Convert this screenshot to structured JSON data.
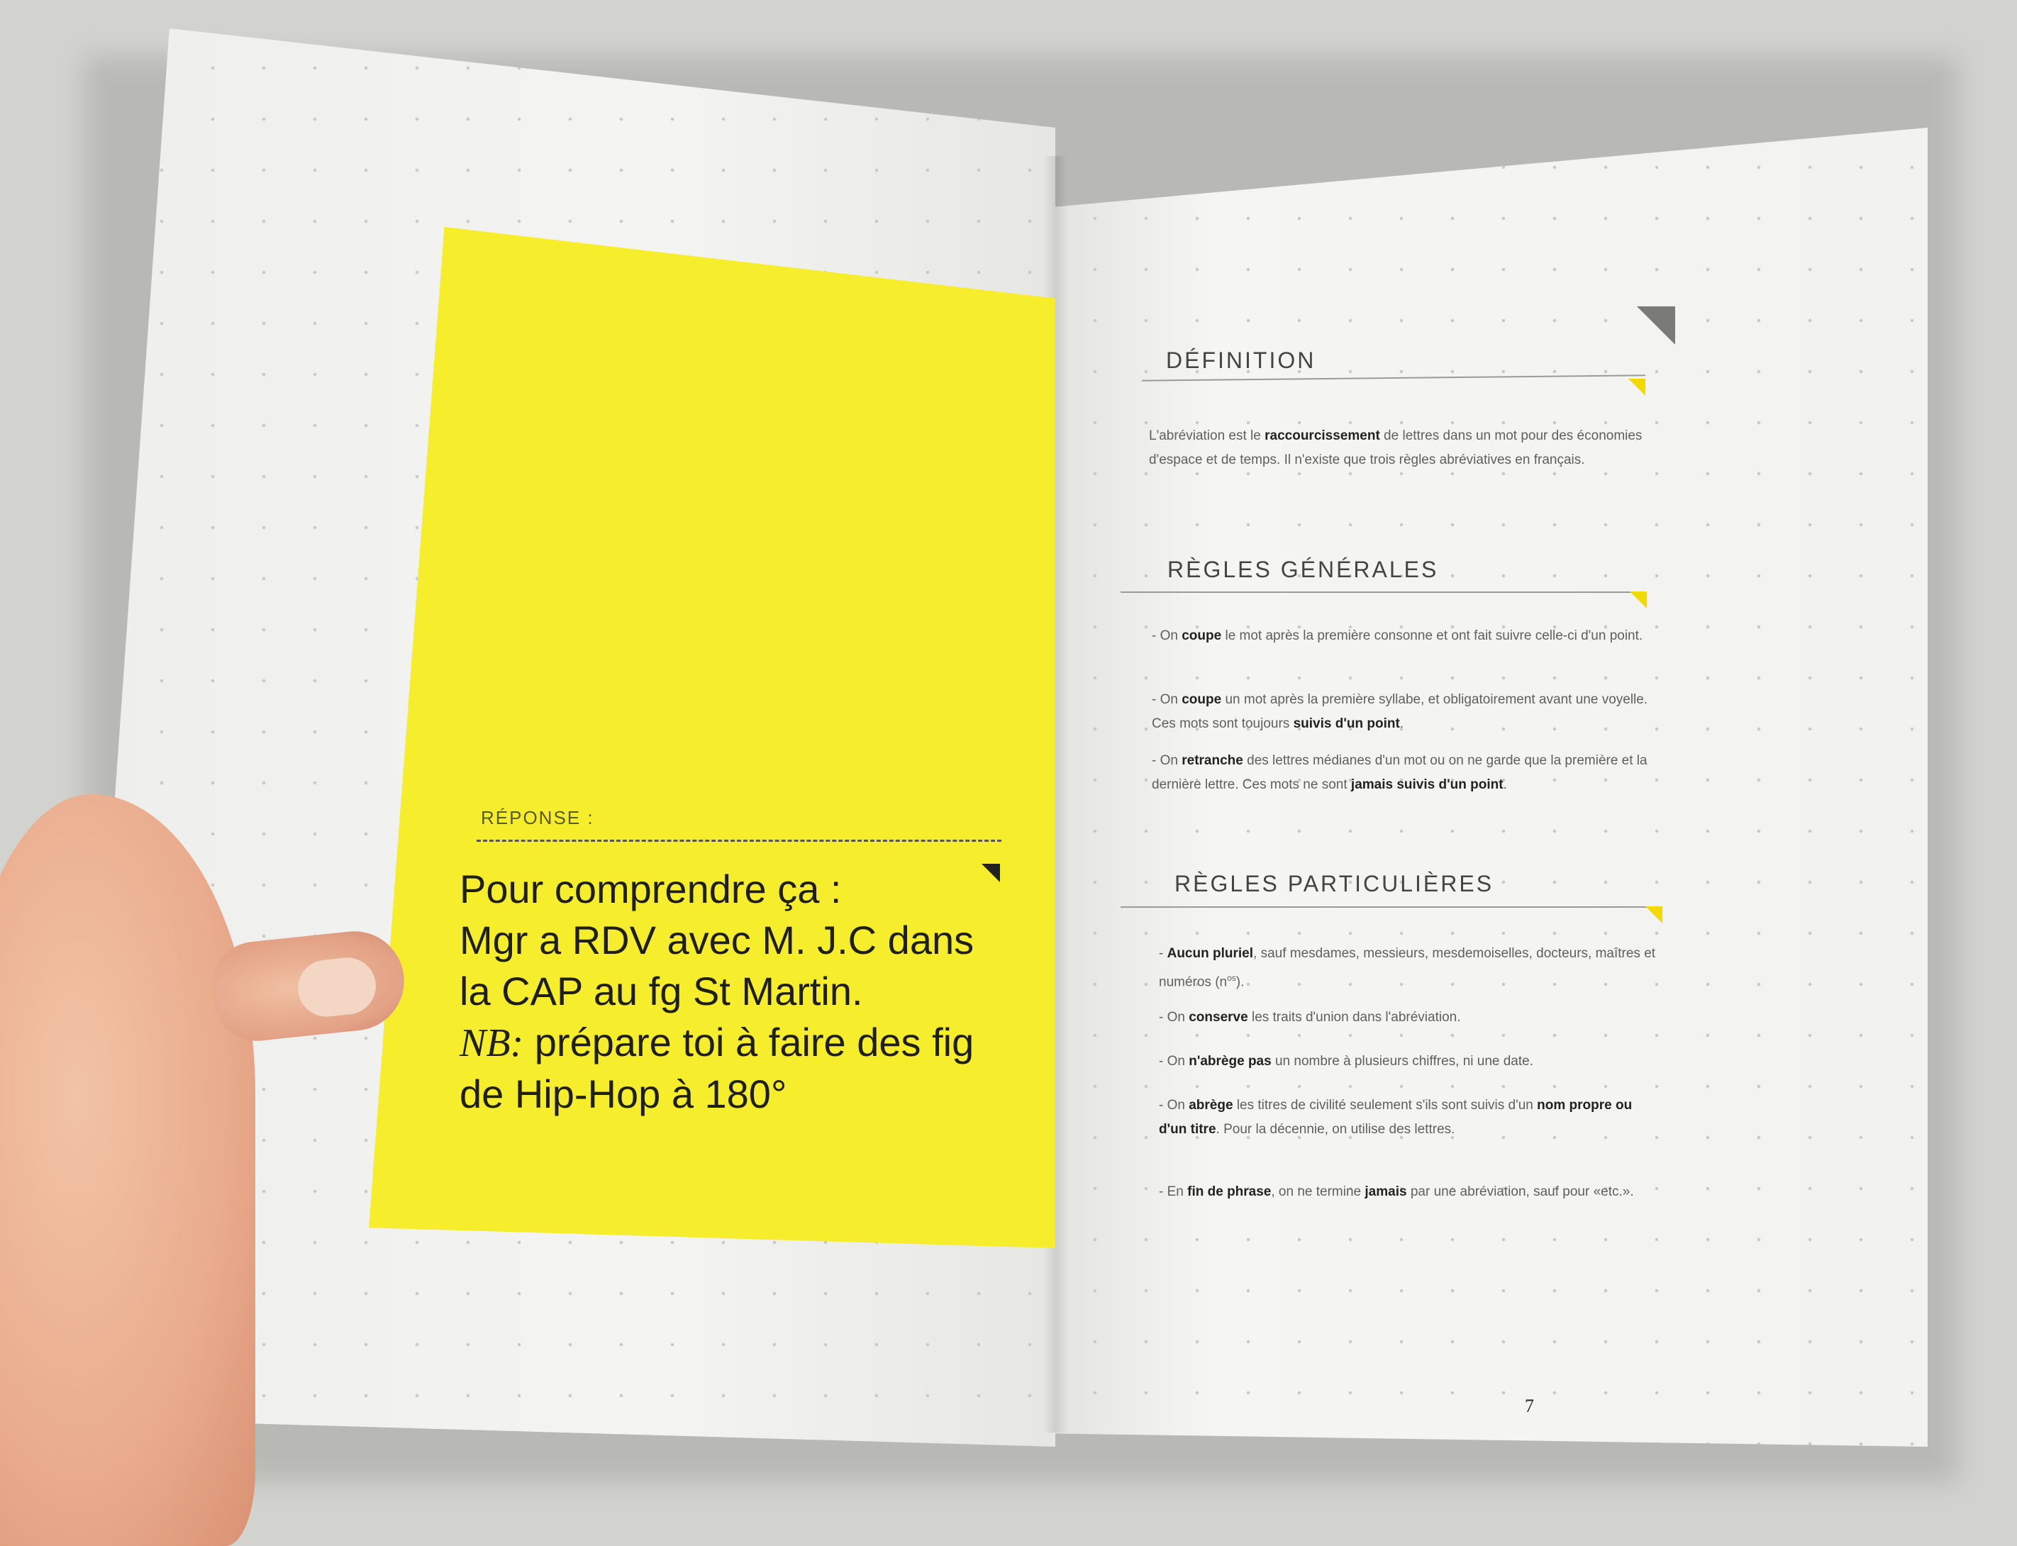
{
  "note": {
    "label": "RÉPONSE :",
    "lines": [
      "Pour comprendre ça :",
      "Mgr a RDV avec M. J.C dans",
      "la CAP au fg St Martin."
    ],
    "nb_label": "NB:",
    "nb_text": " prépare toi à faire des fig",
    "last_line": "de Hip-Hop à 180°"
  },
  "definition": {
    "title": "DÉFINITION",
    "text_before": "L'abréviation est le ",
    "bold": "raccourcissement",
    "text_after": " de lettres dans un mot pour des économies d'espace et de temps. Il n'existe que trois règles abréviatives en français."
  },
  "regles_generales": {
    "title": "RÈGLES GÉNÉRALES",
    "items": [
      {
        "pre": "- On ",
        "bold": "coupe",
        "post": " le mot après la première consonne et ont fait suivre celle-ci d'un point.",
        "bold2": "",
        "post2": ""
      },
      {
        "pre": "- On ",
        "bold": "coupe",
        "post": " un mot après la première syllabe, et obligatoirement avant une voyelle. Ces mots sont toujours ",
        "bold2": "suivis d'un point",
        "post2": "."
      },
      {
        "pre": "- On ",
        "bold": "retranche",
        "post": " des lettres médianes d'un mot ou on ne garde que la première et la dernière lettre. Ces mots ne sont ",
        "bold2": "jamais suivis d'un point",
        "post2": "."
      }
    ]
  },
  "regles_particulieres": {
    "title": "RÈGLES PARTICULIÈRES",
    "items": [
      {
        "pre": "- ",
        "bold": "Aucun pluriel",
        "post": ", sauf mesdames, messieurs, mesdemoiselles, docteurs, maîtres et numéros (n",
        "sup": "os",
        "post2": ")."
      },
      {
        "pre": "- On ",
        "bold": "conserve",
        "post": " les traits d'union dans l'abréviation.",
        "sup": "",
        "post2": ""
      },
      {
        "pre": "- On ",
        "bold": "n'abrège pas",
        "post": " un nombre à plusieurs chiffres, ni une date.",
        "sup": "",
        "post2": ""
      },
      {
        "pre": "- On ",
        "bold": "abrège",
        "post": " les titres de civilité seulement s'ils sont suivis d'un ",
        "bold2": "nom propre ou d'un titre",
        "post3": ". Pour la décennie, on utilise des lettres."
      },
      {
        "pre": "- En ",
        "bold": "fin de phrase",
        "post": ", on ne termine ",
        "bold2": "jamais",
        "post3": " par une abréviation, sauf pour «etc.»."
      }
    ]
  },
  "page_number": "7",
  "colors": {
    "note_yellow": "#f6ee2c",
    "accent_yellow": "#f2d900",
    "accent_gray": "#7a7a78"
  }
}
